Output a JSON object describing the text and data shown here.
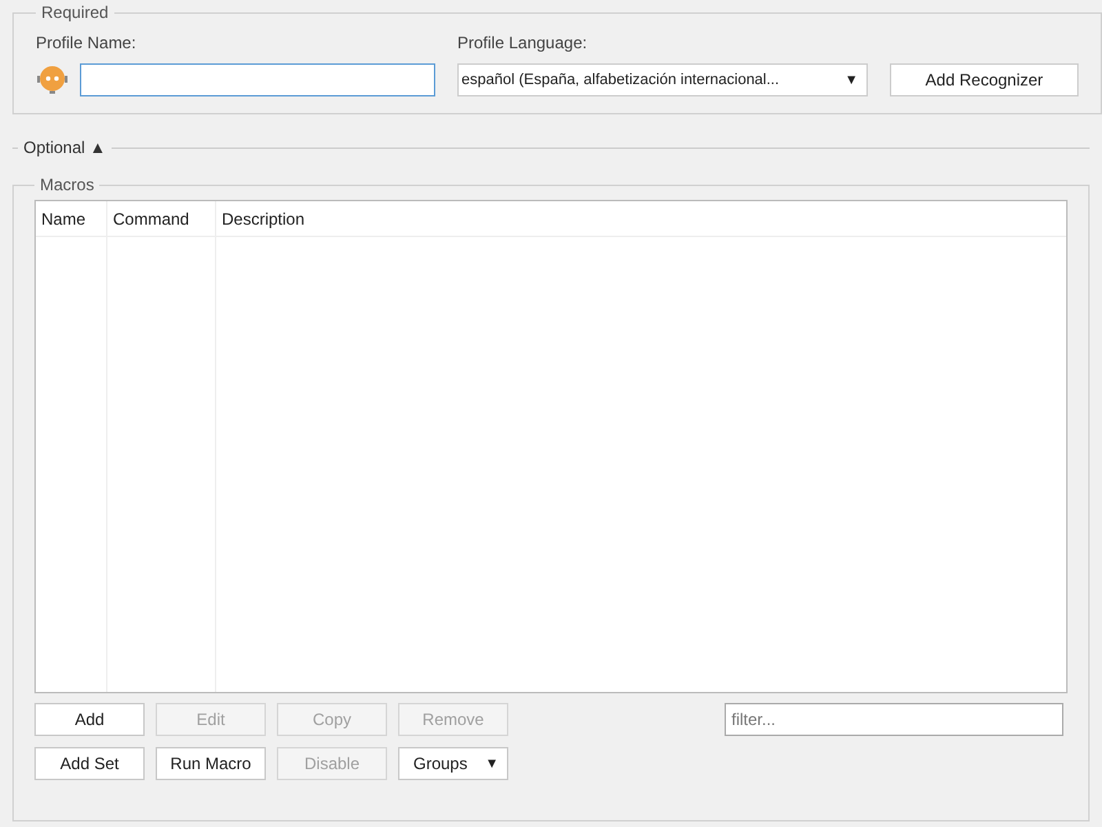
{
  "required": {
    "title": "Required",
    "profile_name": {
      "label": "Profile Name:"
    },
    "profile_language": {
      "label": "Profile Language:",
      "value": "español (España, alfabetización internacional...",
      "arrow": "▼"
    },
    "add_recognizer": "Add Recognizer"
  },
  "optional": {
    "title": "Optional",
    "arrow": "▲",
    "expanded": false
  },
  "macros": {
    "title": "Macros",
    "table": {
      "columns": [
        "Name",
        "Command",
        "Description"
      ]
    },
    "buttons_row_1": [
      {
        "label": "Add",
        "disabled": false
      },
      {
        "label": "Edit",
        "disabled": true
      },
      {
        "label": "Copy",
        "disabled": true
      },
      {
        "label": "Remove",
        "disabled": true
      }
    ],
    "buttons_row_2": [
      {
        "label": "Add Set",
        "disabled": false,
        "kind": "button"
      },
      {
        "label": "Run Macro",
        "disabled": false,
        "kind": "button"
      },
      {
        "label": "Disable",
        "disabled": true,
        "kind": "button"
      },
      {
        "label": "Groups",
        "disabled": false,
        "kind": "dropdown",
        "arrow": "▼"
      }
    ],
    "filter": {
      "placeholder": "filter..."
    }
  }
}
